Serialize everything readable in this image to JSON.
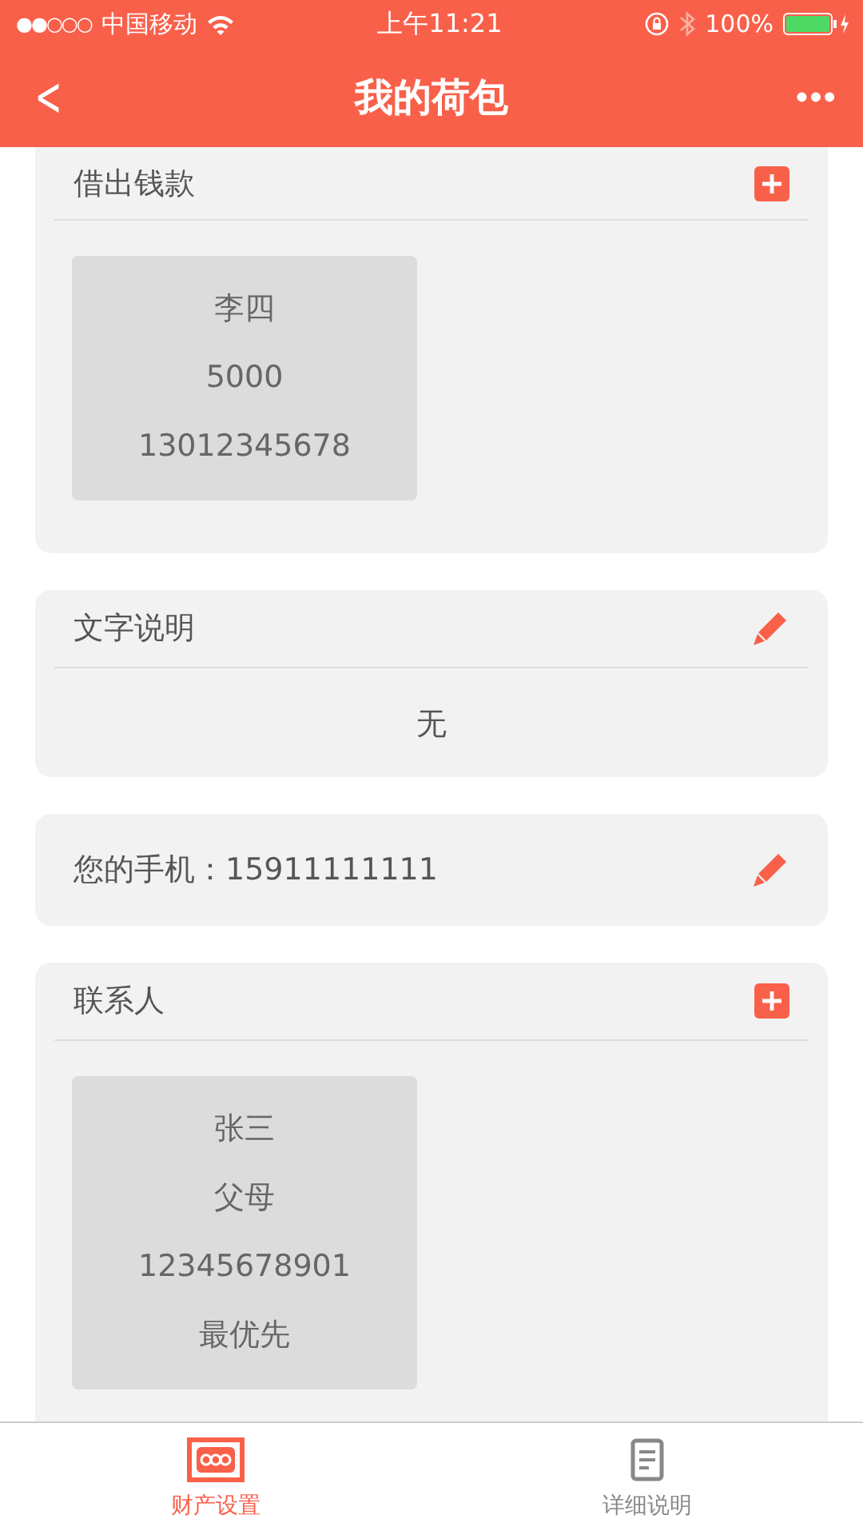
{
  "status_bar": {
    "signal": "●●○○○",
    "carrier": "中国移动",
    "time": "上午11:21",
    "battery": "100%"
  },
  "nav": {
    "back": "<",
    "title": "我的荷包",
    "more": "•••"
  },
  "sections": [
    {
      "kind": "cards",
      "title": "借出钱款",
      "cards": [
        {
          "lines": [
            "李四",
            "5000",
            "13012345678"
          ]
        }
      ]
    },
    {
      "kind": "text",
      "title": "文字说明",
      "body": "无"
    },
    {
      "kind": "field",
      "title": "您的手机：15911111111"
    },
    {
      "kind": "cards",
      "title": "联系人",
      "cards": [
        {
          "lines": [
            "张三",
            "父母",
            "12345678901",
            "最优先"
          ]
        }
      ]
    }
  ],
  "tab_bar": [
    {
      "label": "财产设置",
      "selected": true
    },
    {
      "label": "详细说明",
      "selected": false
    }
  ]
}
